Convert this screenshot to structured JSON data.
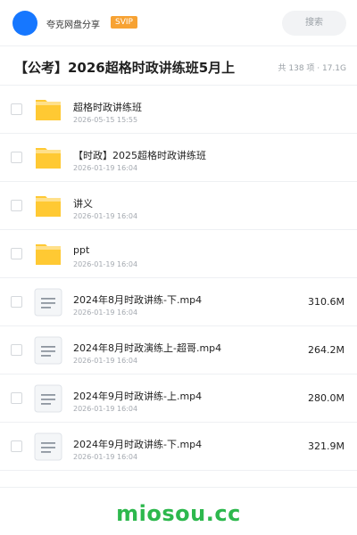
{
  "header": {
    "username": "夸克网盘分享",
    "badge": "SVIP",
    "search_placeholder": "搜索"
  },
  "title_bar": {
    "title": "【公考】2026超格时政讲练班5月上",
    "summary": "共 138 项 · 17.1G"
  },
  "items": [
    {
      "type": "folder",
      "name": "超格时政讲练班",
      "date": "2026-05-15 15:55",
      "size": ""
    },
    {
      "type": "folder",
      "name": "【时政】2025超格时政讲练班",
      "date": "2026-01-19 16:04",
      "size": ""
    },
    {
      "type": "folder",
      "name": "讲义",
      "date": "2026-01-19 16:04",
      "size": ""
    },
    {
      "type": "folder",
      "name": "ppt",
      "date": "2026-01-19 16:04",
      "size": ""
    },
    {
      "type": "file",
      "name": "2024年8月时政讲练-下.mp4",
      "date": "2026-01-19 16:04",
      "size": "310.6M"
    },
    {
      "type": "file",
      "name": "2024年8月时政演练上-超哥.mp4",
      "date": "2026-01-19 16:04",
      "size": "264.2M"
    },
    {
      "type": "file",
      "name": "2024年9月时政讲练-上.mp4",
      "date": "2026-01-19 16:04",
      "size": "280.0M"
    },
    {
      "type": "file",
      "name": "2024年9月时政讲练-下.mp4",
      "date": "2026-01-19 16:04",
      "size": "321.9M"
    }
  ],
  "watermark": "miosou.cc",
  "colors": {
    "accent": "#1677ff",
    "svip": "#f7a233",
    "folder": "#ffc933",
    "watermark": "#2db84d"
  }
}
